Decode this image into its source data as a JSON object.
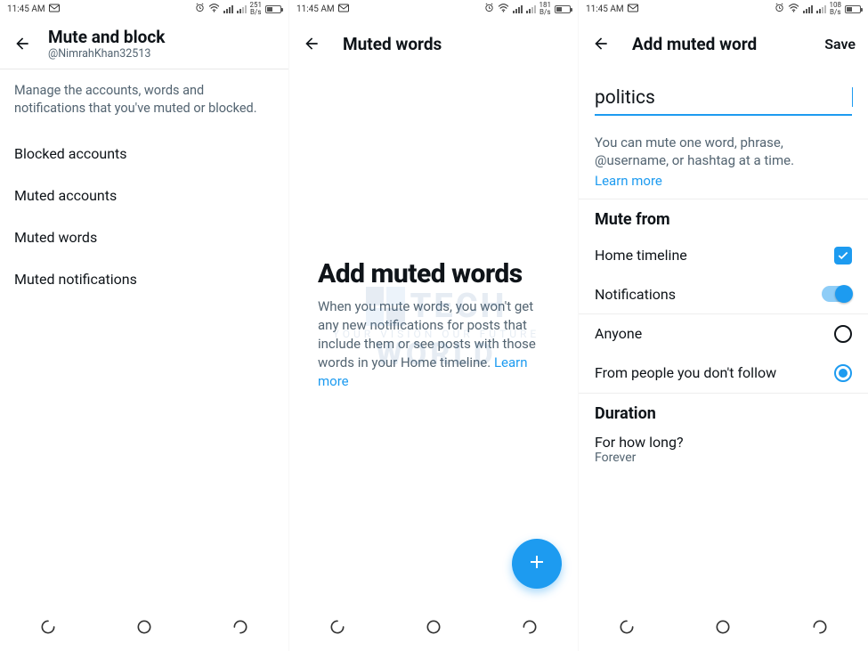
{
  "statusbar": {
    "time": "11:45 AM",
    "rates": [
      "251",
      "181",
      "108"
    ],
    "rate_unit": "B/s"
  },
  "screen1": {
    "title": "Mute and block",
    "subtitle": "@NimrahKhan32513",
    "description": "Manage the accounts, words and notifications that you've muted or blocked.",
    "items": [
      "Blocked accounts",
      "Muted accounts",
      "Muted words",
      "Muted notifications"
    ]
  },
  "screen2": {
    "title": "Muted words",
    "empty_title": "Add muted words",
    "empty_body": "When you mute words, you won't get any new notifications for posts that include them or see posts with those words in your Home timeline.",
    "learn_more": "Learn more"
  },
  "screen3": {
    "title": "Add muted word",
    "save": "Save",
    "input_value": "politics",
    "hint": "You can mute one word, phrase, @username, or hashtag at a time.",
    "learn_more": "Learn more",
    "mute_from_head": "Mute from",
    "home_timeline": "Home timeline",
    "notifications": "Notifications",
    "anyone": "Anyone",
    "from_people": "From people you don't follow",
    "duration_head": "Duration",
    "duration_q": "For how long?",
    "duration_a": "Forever"
  },
  "watermark": {
    "brand1": "TECH",
    "brand2": "WORLD",
    "tag": "YOUR VISION OUR FUTURE"
  }
}
